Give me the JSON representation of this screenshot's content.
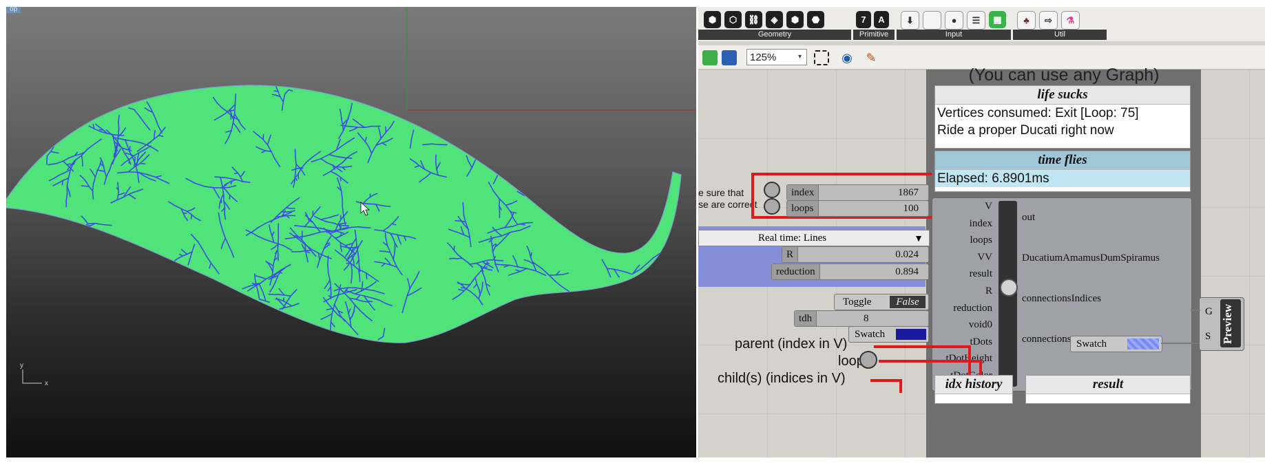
{
  "viewport": {
    "tag": "op",
    "axis_y": "y",
    "axis_x": "x"
  },
  "ribbon": {
    "panels": [
      {
        "label": "Geometry"
      },
      {
        "label": "Primitive"
      },
      {
        "label": "Input"
      },
      {
        "label": "Util"
      }
    ]
  },
  "toolbar": {
    "zoom": "125%"
  },
  "canvas": {
    "graph_title": "(You can use any Graph)",
    "panel_life": {
      "title": "life sucks",
      "lines": [
        "Vertices consumed: Exit [Loop: 75]",
        "Ride a proper Ducati right now"
      ]
    },
    "panel_time": {
      "title": "time flies",
      "line": "Elapsed: 6.8901ms"
    },
    "note": [
      "e sure that",
      "se are correct"
    ],
    "sliders": {
      "index": {
        "name": "index",
        "value": "1867"
      },
      "loops": {
        "name": "loops",
        "value": "100"
      },
      "r": {
        "name": "R",
        "value": "0.024"
      },
      "reduction": {
        "name": "reduction",
        "value": "0.894"
      },
      "tdh": {
        "name": "tdh",
        "value": "8"
      }
    },
    "realtime": "Real time: Lines",
    "toggle": {
      "label": "Toggle",
      "value": "False"
    },
    "swatch_in": "Swatch",
    "swatch_out": "Swatch",
    "component": {
      "inputs": [
        "V",
        "index",
        "loops",
        "VV",
        "result",
        "R",
        "reduction",
        "void0",
        "tDots",
        "tDotHeight",
        "tDotColor"
      ],
      "outputs": [
        "out",
        "DucatiumAmamusDumSpiramus",
        "connectionsIndices",
        "connections"
      ]
    },
    "preview": {
      "label": "Preview",
      "ports": [
        "G",
        "S"
      ]
    },
    "legend": {
      "parent": "parent (index in V)",
      "loop": "loop",
      "child": "child(s) (indices in V)"
    },
    "bottom_panels": [
      "idx history",
      "result"
    ]
  },
  "colors": {
    "leaf_fill": "#4fe37a",
    "vein": "#3a4fe0",
    "wire_red": "#e01a1a",
    "panel_blue": "#bfe6f2"
  }
}
